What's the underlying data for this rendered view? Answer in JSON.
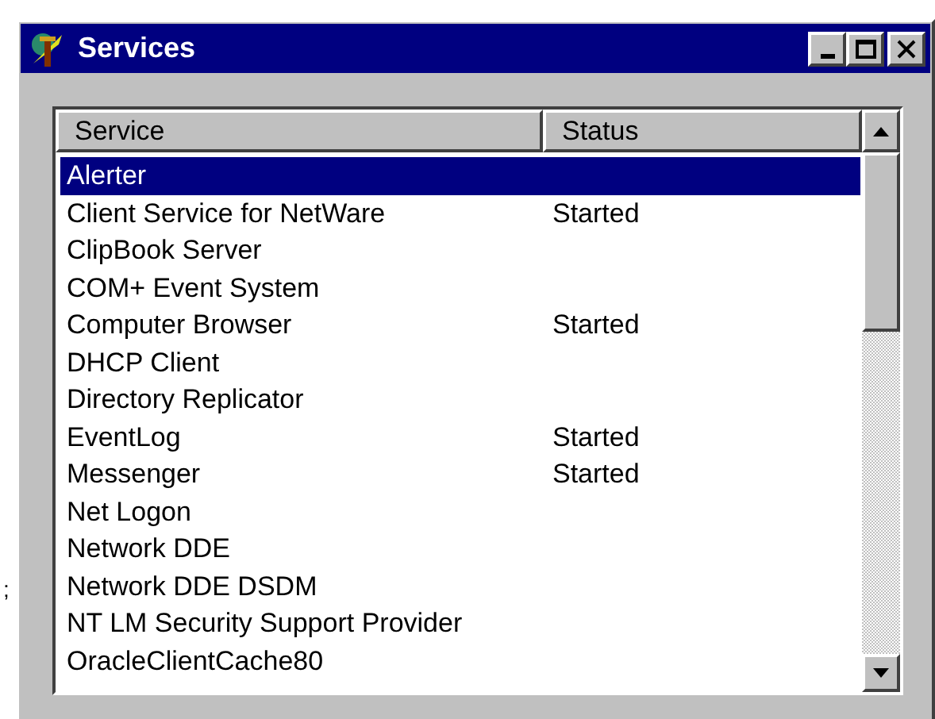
{
  "margin_mark": ";",
  "window": {
    "title": "Services"
  },
  "table": {
    "columns": [
      "Service",
      "Status"
    ],
    "rows": [
      {
        "service": "Alerter",
        "status": "",
        "selected": true
      },
      {
        "service": "Client Service for NetWare",
        "status": "Started",
        "selected": false
      },
      {
        "service": "ClipBook Server",
        "status": "",
        "selected": false
      },
      {
        "service": "COM+ Event System",
        "status": "",
        "selected": false
      },
      {
        "service": "Computer Browser",
        "status": "Started",
        "selected": false
      },
      {
        "service": "DHCP Client",
        "status": "",
        "selected": false
      },
      {
        "service": "Directory Replicator",
        "status": "",
        "selected": false
      },
      {
        "service": "EventLog",
        "status": "Started",
        "selected": false
      },
      {
        "service": "Messenger",
        "status": "Started",
        "selected": false
      },
      {
        "service": "Net Logon",
        "status": "",
        "selected": false
      },
      {
        "service": "Network DDE",
        "status": "",
        "selected": false
      },
      {
        "service": "Network DDE DSDM",
        "status": "",
        "selected": false
      },
      {
        "service": "NT LM Security Support Provider",
        "status": "",
        "selected": false
      },
      {
        "service": "OracleClientCache80",
        "status": "",
        "selected": false
      }
    ]
  }
}
